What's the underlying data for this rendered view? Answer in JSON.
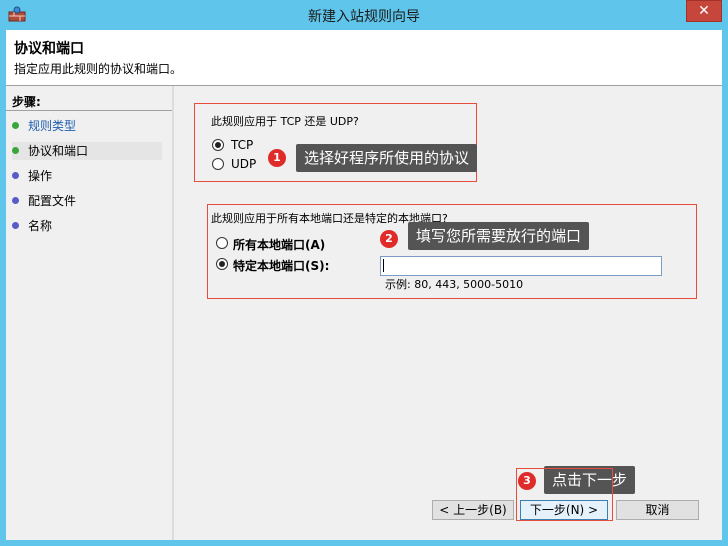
{
  "window": {
    "title": "新建入站规则向导",
    "close_glyph": "✕"
  },
  "header": {
    "title": "协议和端口",
    "subtitle": "指定应用此规则的协议和端口。"
  },
  "steps": {
    "title": "步骤:",
    "items": [
      {
        "label": "规则类型",
        "status": "done",
        "dot_color": "#3aa53a"
      },
      {
        "label": "协议和端口",
        "status": "current",
        "dot_color": "#3aa53a"
      },
      {
        "label": "操作",
        "status": "pending",
        "dot_color": "#5a5ac8"
      },
      {
        "label": "配置文件",
        "status": "pending",
        "dot_color": "#5a5ac8"
      },
      {
        "label": "名称",
        "status": "pending",
        "dot_color": "#5a5ac8"
      }
    ]
  },
  "protocol": {
    "question": "此规则应用于 TCP 还是 UDP?",
    "options": [
      {
        "label": "TCP",
        "checked": true
      },
      {
        "label": "UDP",
        "checked": false
      }
    ]
  },
  "ports": {
    "question": "此规则应用于所有本地端口还是特定的本地端口?",
    "options": [
      {
        "label": "所有本地端口(A)",
        "checked": false
      },
      {
        "label": "特定本地端口(S):",
        "checked": true
      }
    ],
    "input_value": "",
    "example": "示例: 80, 443, 5000-5010"
  },
  "annotations": [
    {
      "number": "1",
      "text": "选择好程序所使用的协议"
    },
    {
      "number": "2",
      "text": "填写您所需要放行的端口"
    },
    {
      "number": "3",
      "text": "点击下一步"
    }
  ],
  "buttons": {
    "back": "< 上一步(B)",
    "next": "下一步(N) >",
    "cancel": "取消"
  },
  "colors": {
    "titlebar": "#5fc5ea",
    "annotation_frame": "#e74c3c",
    "badge": "#e02b2b",
    "tooltip": "#545454"
  }
}
